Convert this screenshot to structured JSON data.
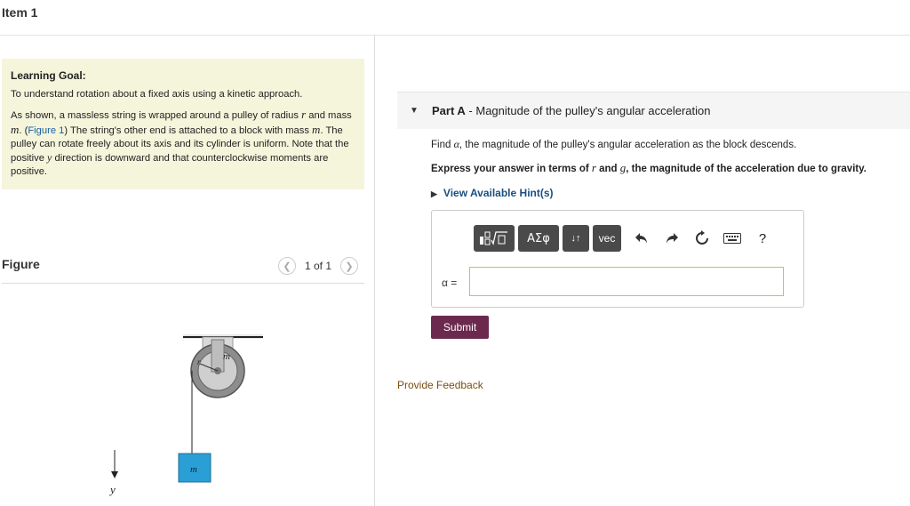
{
  "header": {
    "title": "Item 1"
  },
  "learning_goal": {
    "title": "Learning Goal:",
    "intro": "To understand rotation about a fixed axis using a kinetic approach.",
    "p2_a": "As shown, a massless string is wrapped around a pulley of radius ",
    "p2_r": "r",
    "p2_b": " and mass ",
    "p2_m1": "m",
    "p2_c": ". (",
    "p2_figlink": "Figure 1",
    "p2_d": ") The string's other end is attached to a block with mass ",
    "p2_m2": "m",
    "p2_e": ". The pulley can rotate freely about its axis and its cylinder is uniform. Note that the positive ",
    "p2_y": "y",
    "p2_f": " direction is downward and that counterclockwise moments are positive."
  },
  "figure": {
    "label": "Figure",
    "pager": "1 of 1",
    "pulley_mass_label": "m",
    "radius_label": "r",
    "block_label": "m",
    "axis_label": "y",
    "colors": {
      "block": "#2a9fd6",
      "pulley_outer": "#8d8d8d",
      "pulley_inner": "#cfcfcf",
      "mount": "#d9d9d9"
    }
  },
  "part_a": {
    "prefix": "Part A",
    "title": " - Magnitude of the pulley's angular acceleration",
    "prompt_a": "Find ",
    "prompt_alpha": "α",
    "prompt_b": ", the magnitude of the pulley's angular acceleration as the block descends.",
    "express_a": "Express your answer in terms of ",
    "express_r": "r",
    "express_b": " and ",
    "express_g": "g",
    "express_c": ", the magnitude of the acceleration due to gravity.",
    "hints_label": "View Available Hint(s)",
    "toolbar": {
      "templates_icon": "fraction-root-templates-icon",
      "greek_label": "ΑΣφ",
      "sort_label": "↓↑",
      "vec_label": "vec",
      "undo_icon": "undo-icon",
      "redo_icon": "redo-icon",
      "reset_icon": "reset-icon",
      "keyboard_icon": "keyboard-icon",
      "help_label": "?"
    },
    "answer_label": "α =",
    "answer_value": "",
    "submit_label": "Submit"
  },
  "feedback_label": "Provide Feedback",
  "colors": {
    "submit": "#6b2a4d",
    "goal_bg": "#f5f5dc",
    "link": "#1a5fa0",
    "feedback": "#7a4e10"
  }
}
